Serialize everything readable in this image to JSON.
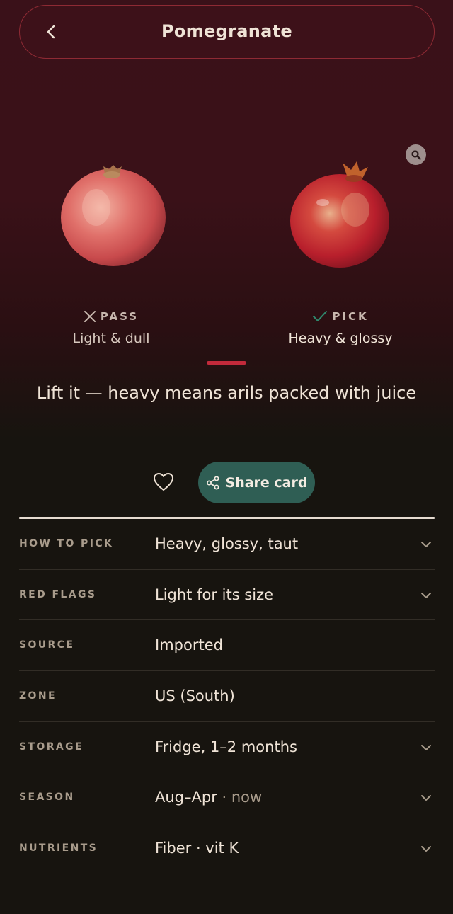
{
  "header": {
    "title": "Pomegranate"
  },
  "comparison": {
    "pass": {
      "tag": "PASS",
      "description": "Light & dull"
    },
    "pick": {
      "tag": "PICK",
      "description": "Heavy & glossy"
    }
  },
  "tip": "Lift it — heavy means arils packed with juice",
  "actions": {
    "share_label": "Share card"
  },
  "details": [
    {
      "label": "HOW TO PICK",
      "value": "Heavy, glossy, taut",
      "extra": "",
      "expandable": true
    },
    {
      "label": "RED FLAGS",
      "value": "Light for its size",
      "extra": "",
      "expandable": true
    },
    {
      "label": "SOURCE",
      "value": "Imported",
      "extra": "",
      "expandable": false
    },
    {
      "label": "ZONE",
      "value": "US (South)",
      "extra": "",
      "expandable": false
    },
    {
      "label": "STORAGE",
      "value": "Fridge, 1–2 months",
      "extra": "",
      "expandable": true
    },
    {
      "label": "SEASON",
      "value": "Aug–Apr",
      "extra": " · now",
      "expandable": true
    },
    {
      "label": "NUTRIENTS",
      "value": "Fiber · vit K",
      "extra": "",
      "expandable": true
    }
  ],
  "colors": {
    "hero_background": "#3a1119",
    "accent_red": "#c22a3b",
    "share_button": "#2f5e54",
    "pick_check": "#2f8a6e"
  },
  "icons": {
    "back": "chevron-left-icon",
    "zoom": "magnifier-icon",
    "pass": "x-icon",
    "pick": "check-icon",
    "favorite": "heart-icon",
    "share": "share-icon",
    "expand": "chevron-down-icon"
  }
}
